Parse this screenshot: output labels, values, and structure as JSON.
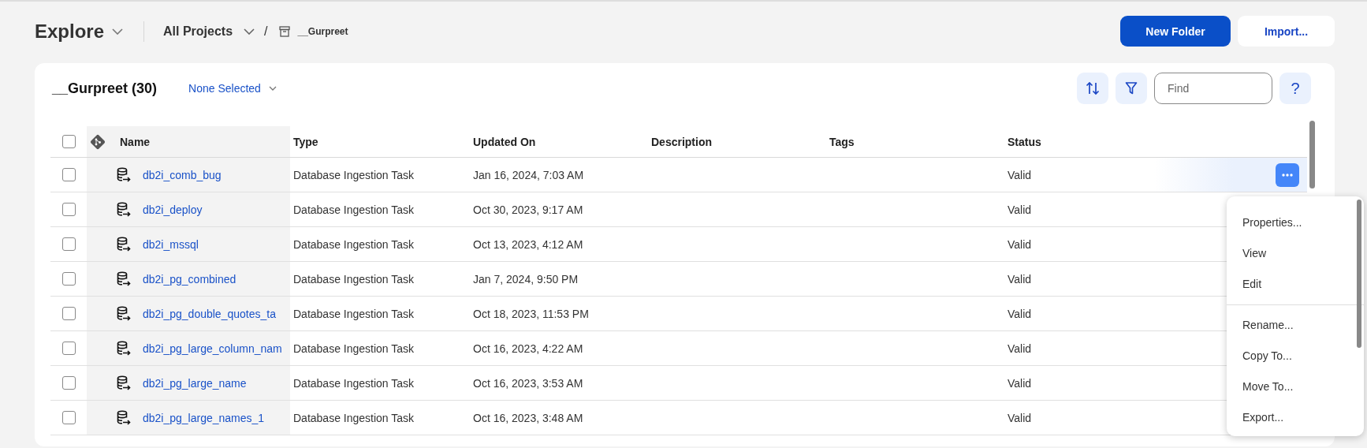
{
  "header": {
    "title": "Explore",
    "separator": "/",
    "breadcrumb": [
      {
        "label": "All Projects",
        "kind": "dropdown"
      },
      {
        "label": "__Gurpreet",
        "kind": "folder"
      }
    ],
    "buttons": [
      {
        "label": "New Folder",
        "primary": true
      },
      {
        "label": "Import...",
        "primary": false
      }
    ]
  },
  "panel": {
    "title": "__Gurpreet (30)",
    "selection": "None Selected",
    "search": {
      "placeholder": "Find"
    },
    "help": "?"
  },
  "table": {
    "select_all_checked": false,
    "columns": [
      "Name",
      "Type",
      "Updated On",
      "Description",
      "Tags",
      "Status"
    ],
    "rows": [
      {
        "name": "db2i_comb_bug",
        "type": "Database Ingestion Task",
        "updated_on": "Jan 16, 2024, 7:03 AM",
        "status": "Valid",
        "checked": false,
        "hovered": true
      },
      {
        "name": "db2i_deploy",
        "type": "Database Ingestion Task",
        "updated_on": "Oct 30, 2023, 9:17 AM",
        "status": "Valid",
        "checked": false,
        "hovered": false
      },
      {
        "name": "db2i_mssql",
        "type": "Database Ingestion Task",
        "updated_on": "Oct 13, 2023, 4:12 AM",
        "status": "Valid",
        "checked": false,
        "hovered": false
      },
      {
        "name": "db2i_pg_combined",
        "type": "Database Ingestion Task",
        "updated_on": "Jan 7, 2024, 9:50 PM",
        "status": "Valid",
        "checked": false,
        "hovered": false
      },
      {
        "name": "db2i_pg_double_quotes_ta",
        "type": "Database Ingestion Task",
        "updated_on": "Oct 18, 2023, 11:53 PM",
        "status": "Valid",
        "checked": false,
        "hovered": false
      },
      {
        "name": "db2i_pg_large_column_nam",
        "type": "Database Ingestion Task",
        "updated_on": "Oct 16, 2023, 4:22 AM",
        "status": "Valid",
        "checked": false,
        "hovered": false
      },
      {
        "name": "db2i_pg_large_name",
        "type": "Database Ingestion Task",
        "updated_on": "Oct 16, 2023, 3:53 AM",
        "status": "Valid",
        "checked": false,
        "hovered": false
      },
      {
        "name": "db2i_pg_large_names_1",
        "type": "Database Ingestion Task",
        "updated_on": "Oct 16, 2023, 3:48 AM",
        "status": "Valid",
        "checked": false,
        "hovered": false
      }
    ]
  },
  "context_menu": {
    "groups": [
      [
        "Properties...",
        "View",
        "Edit"
      ],
      [
        "Rename...",
        "Copy To...",
        "Move To...",
        "Export..."
      ]
    ]
  }
}
